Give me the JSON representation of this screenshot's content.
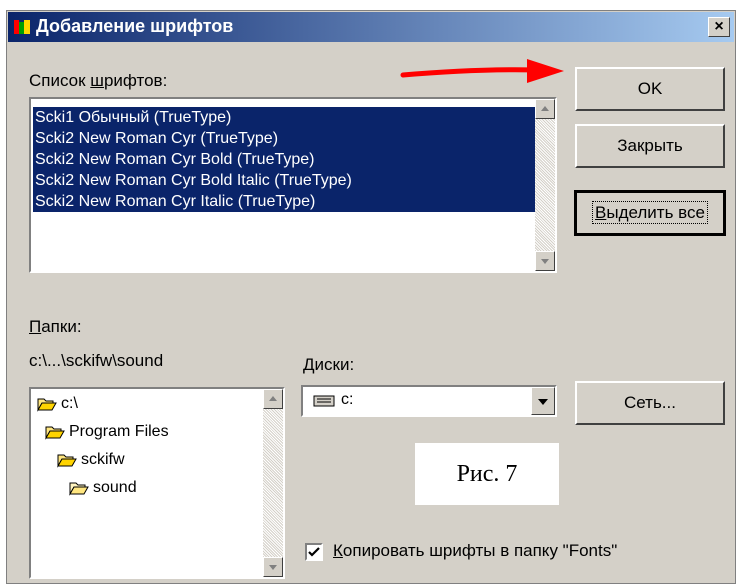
{
  "window": {
    "title": "Добавление шрифтов",
    "close": "×"
  },
  "font_list": {
    "label_u": "ш",
    "label_pre": "Список ",
    "label_post": "рифтов:",
    "items": [
      "Scki1 Обычный (TrueType)",
      "Scki2 New Roman Cyr (TrueType)",
      "Scki2 New Roman Cyr Bold (TrueType)",
      "Scki2 New Roman Cyr Bold Italic (TrueType)",
      "Scki2 New Roman Cyr Italic (TrueType)"
    ]
  },
  "buttons": {
    "ok": "OK",
    "close": "Закрыть",
    "select_all_u": "В",
    "select_all_rest": "ыделить все",
    "network": "Сеть..."
  },
  "folders": {
    "label_u": "П",
    "label_rest": "апки:",
    "path": "c:\\...\\sckifw\\sound",
    "items": [
      "c:\\",
      "Program Files",
      "sckifw",
      "sound"
    ]
  },
  "drives": {
    "label_u": "Д",
    "label_rest": "иски:",
    "value": "c:"
  },
  "caption": "Рис. 7",
  "copy_checkbox": {
    "checked": true,
    "label_u": "К",
    "label_rest": "опировать шрифты в папку \"Fonts\""
  },
  "colors": {
    "selection": "#0a246a",
    "face": "#d4d0c8",
    "arrow": "#ff0000"
  }
}
